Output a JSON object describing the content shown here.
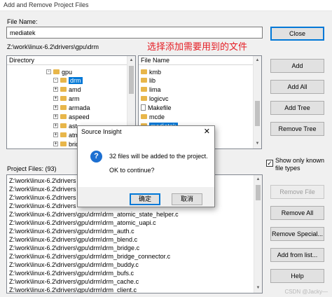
{
  "window": {
    "title": "Add and Remove Project Files"
  },
  "file_name": {
    "label": "File Name:",
    "value": "mediatek"
  },
  "current_path": "Z:\\work\\linux-6.2\\drivers\\gpu\\drm",
  "annotation": "选择添加需要用到的文件",
  "directory": {
    "header": "Directory",
    "items": [
      {
        "label": "gpu",
        "expander": "-"
      },
      {
        "label": "drm",
        "expander": "-",
        "selected": true
      },
      {
        "label": "amd",
        "expander": "+"
      },
      {
        "label": "arm",
        "expander": "+"
      },
      {
        "label": "armada",
        "expander": "+"
      },
      {
        "label": "aspeed",
        "expander": "+"
      },
      {
        "label": "ast",
        "expander": "+"
      },
      {
        "label": "atm",
        "expander": "+"
      },
      {
        "label": "brid",
        "expander": "+"
      }
    ]
  },
  "file_name_list": {
    "header": "File Name",
    "items": [
      {
        "label": "kmb",
        "type": "folder"
      },
      {
        "label": "lib",
        "type": "folder"
      },
      {
        "label": "lima",
        "type": "folder"
      },
      {
        "label": "logicvc",
        "type": "folder"
      },
      {
        "label": "Makefile",
        "type": "file"
      },
      {
        "label": "mcde",
        "type": "folder"
      },
      {
        "label": "mediatek",
        "type": "folder",
        "selected": true
      }
    ]
  },
  "project_files": {
    "label": "Project Files: (93)",
    "items": [
      "Z:\\work\\linux-6.2\\drivers",
      "Z:\\work\\linux-6.2\\drivers",
      "Z:\\work\\linux-6.2\\drivers",
      "Z:\\work\\linux-6.2\\drivers",
      "Z:\\work\\linux-6.2\\drivers\\gpu\\drm\\drm_atomic_state_helper.c",
      "Z:\\work\\linux-6.2\\drivers\\gpu\\drm\\drm_atomic_uapi.c",
      "Z:\\work\\linux-6.2\\drivers\\gpu\\drm\\drm_auth.c",
      "Z:\\work\\linux-6.2\\drivers\\gpu\\drm\\drm_blend.c",
      "Z:\\work\\linux-6.2\\drivers\\gpu\\drm\\drm_bridge.c",
      "Z:\\work\\linux-6.2\\drivers\\gpu\\drm\\drm_bridge_connector.c",
      "Z:\\work\\linux-6.2\\drivers\\gpu\\drm\\drm_buddy.c",
      "Z:\\work\\linux-6.2\\drivers\\gpu\\drm\\drm_bufs.c",
      "Z:\\work\\linux-6.2\\drivers\\gpu\\drm\\drm_cache.c",
      "Z:\\work\\linux-6.2\\drivers\\gpu\\drm\\drm_client.c"
    ]
  },
  "buttons": {
    "close": "Close",
    "add": "Add",
    "add_all": "Add All",
    "add_tree": "Add Tree",
    "remove_tree": "Remove Tree",
    "remove_file": "Remove File",
    "remove_all": "Remove All",
    "remove_special": "Remove Special...",
    "add_from_list": "Add from list...",
    "help": "Help"
  },
  "show_only_known": {
    "label_line1": "Show only known",
    "label_line2": "file types",
    "checked": true,
    "mark": "✓"
  },
  "dialog": {
    "title": "Source Insight",
    "icon": "?",
    "message": "32 files will be added to the project.",
    "question": "OK to continue?",
    "ok": "确定",
    "cancel": "取消",
    "close_glyph": "✕"
  },
  "watermark": "CSDN @Jacky—"
}
